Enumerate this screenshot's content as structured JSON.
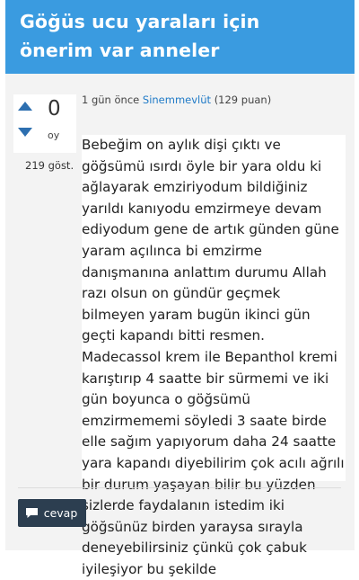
{
  "header": {
    "title_line1": "Göğüs ucu yaraları için",
    "title_line2": "önerim var anneler"
  },
  "vote": {
    "count": "0",
    "unit": "oy",
    "up_icon": "arrow-up-icon",
    "down_icon": "arrow-down-icon"
  },
  "views": "219 göst.",
  "meta": {
    "time": "1 gün önce",
    "user": "Sinemmevlüt",
    "points": "(129 puan)"
  },
  "post": {
    "body": "Bebeğim on aylık dişi çıktı ve göğsümü ısırdı öyle bir yara oldu ki ağlayarak emziriyodum bildiğiniz yarıldı kanıyodu emzirmeye devam ediyodum gene de artık günden güne yaram açılınca bi emzirme danışmanına anlattım durumu Allah razı olsun on gündür geçmek bilmeyen yaram bugün ikinci gün geçti kapandı bitti resmen. Madecassol krem ile Bepanthol kremi karıştırıp 4 saatte bir sürmemi ve iki gün boyunca o göğsümü emzirmememi söyledi 3 saate birde elle sağım yapıyorum daha 24 saatte yara kapandı diyebilirim çok acılı ağrılı bir durum yaşayan bilir bu yüzden sizlerde faydalanın istedim iki göğsünüz birden yaraysa sırayla deneyebilirsiniz çünkü çok çabuk iyileşiyor bu şekilde"
  },
  "reply_button": {
    "label": "cevap",
    "icon": "comment-icon"
  },
  "colors": {
    "header_bg": "#3a9be0",
    "accent": "#2d6fb0",
    "link": "#1f7ac7",
    "button_bg": "#2c3e50",
    "card_bg": "#f3f3f3"
  }
}
